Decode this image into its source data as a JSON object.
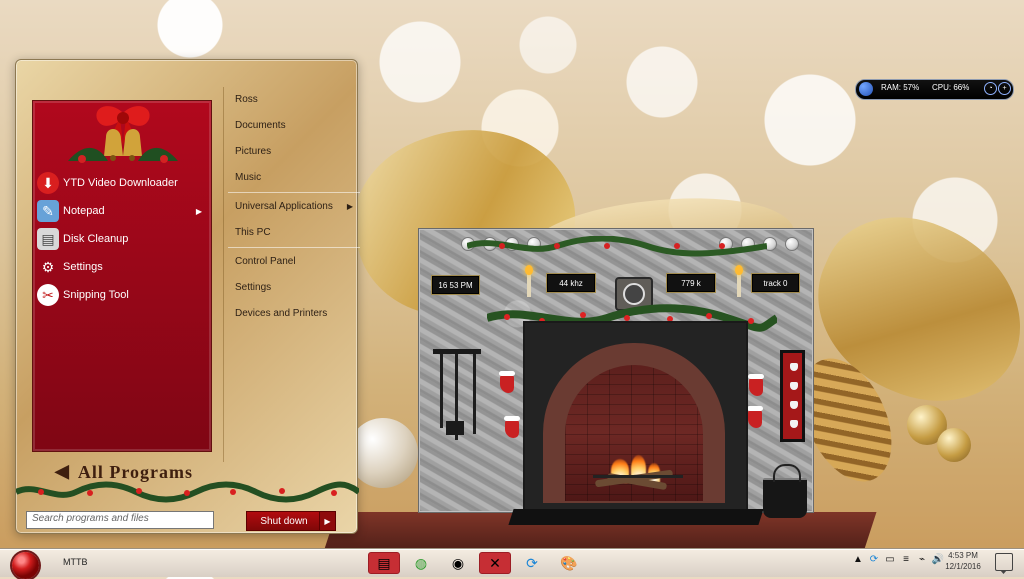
{
  "start_menu": {
    "left_items": [
      {
        "label": "YTD Video Downloader",
        "icon": "video-downloader-icon"
      },
      {
        "label": "Notepad",
        "icon": "notepad-icon",
        "has_arrow": true
      },
      {
        "label": "Disk Cleanup",
        "icon": "disk-cleanup-icon"
      },
      {
        "label": "Settings",
        "icon": "gear-icon"
      },
      {
        "label": "Snipping Tool",
        "icon": "snipping-tool-icon"
      }
    ],
    "right_items": [
      "Ross",
      "Documents",
      "Pictures",
      "Music",
      "Universal Applications",
      "This PC",
      "Control Panel",
      "Settings",
      "Devices and Printers"
    ],
    "all_programs": "All Programs",
    "search_placeholder": "Search programs and files",
    "shutdown_label": "Shut down"
  },
  "fireplace_widget": {
    "time": "16 53 PM",
    "sample_rate": "44 khz",
    "bitrate": "779 k",
    "track": "track 0"
  },
  "system_meter": {
    "ram": "RAM: 57%",
    "cpu": "CPU: 66%"
  },
  "taskbar": {
    "label": "MTTB",
    "time": "4:53 PM",
    "date": "12/1/2016"
  }
}
